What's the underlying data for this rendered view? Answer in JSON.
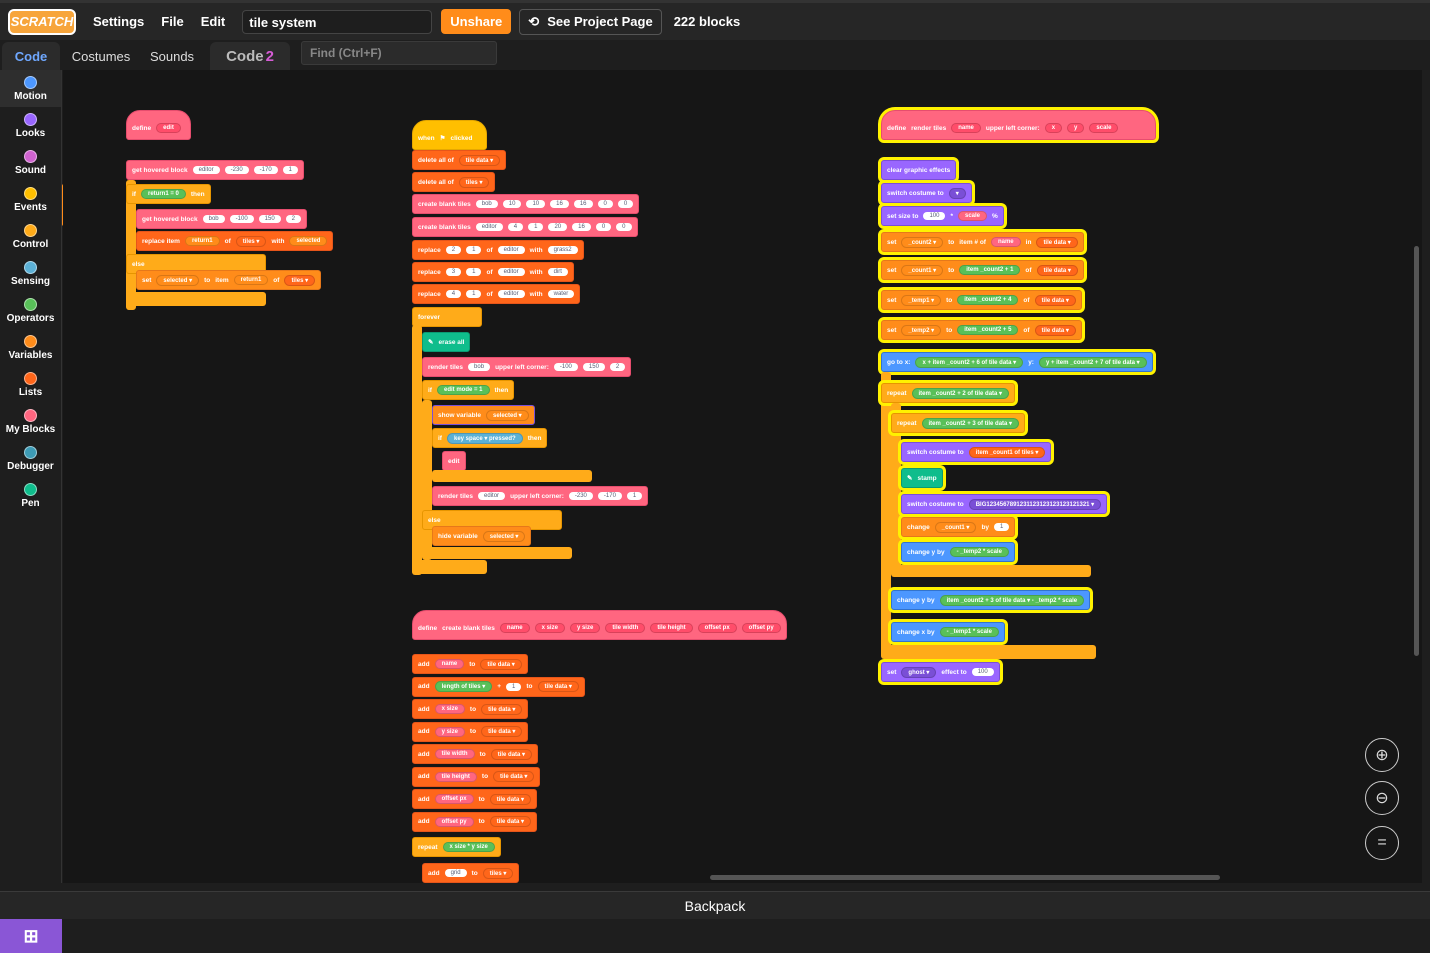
{
  "menubar": {
    "logo": "SCRATCH",
    "settings": "Settings",
    "file": "File",
    "edit": "Edit",
    "project_title": "tile system",
    "unshare": "Unshare",
    "see_project": "See Project Page",
    "block_count": "222 blocks"
  },
  "tabs": {
    "code": "Code",
    "costumes": "Costumes",
    "sounds": "Sounds",
    "code2": "Code",
    "code2_badge": "2"
  },
  "find": {
    "placeholder": "Find (Ctrl+F)"
  },
  "categories": [
    {
      "label": "Motion",
      "color": "#4c97ff"
    },
    {
      "label": "Looks",
      "color": "#9966ff"
    },
    {
      "label": "Sound",
      "color": "#cf63cf"
    },
    {
      "label": "Events",
      "color": "#ffbf00"
    },
    {
      "label": "Control",
      "color": "#ffab19"
    },
    {
      "label": "Sensing",
      "color": "#5cb1d6"
    },
    {
      "label": "Operators",
      "color": "#59c059"
    },
    {
      "label": "Variables",
      "color": "#ff8c1a"
    },
    {
      "label": "Lists",
      "color": "#ff661a"
    },
    {
      "label": "My Blocks",
      "color": "#ff6680"
    },
    {
      "label": "Debugger",
      "color": "#3d9bb5"
    },
    {
      "label": "Pen",
      "color": "#0fbd8c"
    }
  ],
  "backpack": "Backpack",
  "scripts": {
    "s1": {
      "define": "define",
      "edit": "edit",
      "get_hovered": "get hovered block",
      "editor": "editor",
      "v1": "-230",
      "v2": "-170",
      "v3": "1",
      "if": "if",
      "return1": "return1",
      "eq": "=",
      "zero": "0",
      "then": "then",
      "get_hovered2": "get hovered block",
      "bob": "bob",
      "v4": "-100",
      "v5": "150",
      "v6": "2",
      "replace_item": "replace item",
      "of": "of",
      "tiles": "tiles ▾",
      "with": "with",
      "selected": "selected",
      "else": "else",
      "set": "set",
      "selected_dd": "selected ▾",
      "to": "to",
      "item": "item"
    },
    "s2": {
      "when": "when",
      "clicked": "clicked",
      "delete_all": "delete all of",
      "tile_data": "tile data ▾",
      "tiles": "tiles ▾",
      "create_blank": "create blank tiles",
      "bob": "bob",
      "editor": "editor",
      "c1": [
        "10",
        "10",
        "16",
        "16",
        "0",
        "0"
      ],
      "c2": [
        "4",
        "1",
        "20",
        "16",
        "0",
        "0"
      ],
      "replace": "replace",
      "of": "of",
      "with": "with",
      "r1": [
        "2",
        "1",
        "grass2"
      ],
      "r2": [
        "3",
        "1",
        "dirt"
      ],
      "r3": [
        "4",
        "1",
        "water"
      ],
      "forever": "forever",
      "erase_all": "erase all",
      "render_tiles": "render tiles",
      "upper_left": "upper left corner:",
      "rv1": [
        "-100",
        "150",
        "2"
      ],
      "if": "if",
      "edit_mode": "edit mode",
      "eq": "=",
      "one": "1",
      "then": "then",
      "show_var": "show variable",
      "selected": "selected ▾",
      "key": "key",
      "space": "space ▾",
      "pressed": "pressed?",
      "edit": "edit",
      "rv2": [
        "-230",
        "-170",
        "1"
      ],
      "else": "else",
      "hide_var": "hide variable"
    },
    "s3": {
      "define": "define",
      "create_blank": "create blank tiles",
      "params": [
        "name",
        "x size",
        "y size",
        "tile width",
        "tile height",
        "offset px",
        "offset py"
      ],
      "add": "add",
      "to": "to",
      "tile_data": "tile data ▾",
      "length_of": "length of",
      "tiles": "tiles ▾",
      "plus": "+",
      "one": "1",
      "repeat": "repeat",
      "times": "*",
      "grid": "grid"
    },
    "s4": {
      "define": "define",
      "render_tiles": "render tiles",
      "name": "name",
      "upper_left": "upper left corner:",
      "x": "x",
      "y": "y",
      "scale": "scale",
      "clear_graphic": "clear graphic effects",
      "switch_costume": "switch costume to",
      "set_size": "set size to",
      "hundred": "100",
      "times": "*",
      "percent": "%",
      "set": "set",
      "count2": "_count2 ▾",
      "to": "to",
      "item_num": "item # of",
      "in": "in",
      "tile_data": "tile data ▾",
      "count1": "_count1 ▾",
      "item": "item",
      "_count2": "_count2",
      "plus": "+",
      "of": "of",
      "temp1": "_temp1 ▾",
      "temp2": "_temp2 ▾",
      "n1": "1",
      "n4": "4",
      "n5": "5",
      "n6": "6",
      "n7": "7",
      "n2": "2",
      "n3": "3",
      "go_to": "go to x:",
      "y_label": "y:",
      "repeat": "repeat",
      "_count1": "_count1",
      "tiles": "tiles ▾",
      "stamp": "stamp",
      "costume_str": "BIG1234567891231123123123123121321",
      "change": "change",
      "by": "by",
      "change_y": "change y by",
      "change_x": "change x by",
      "minus": "-",
      "_temp2": "_temp2",
      "_temp1": "_temp1",
      "ghost": "ghost ▾",
      "effect_to": "effect to",
      "set_lbl": "set"
    }
  }
}
